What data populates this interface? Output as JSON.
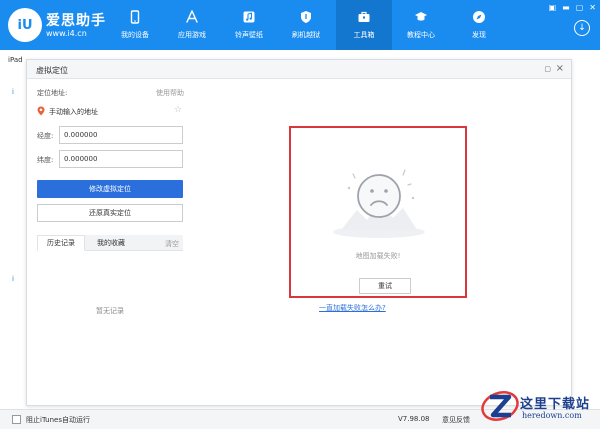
{
  "app": {
    "brand_name": "爱思助手",
    "brand_url": "www.i4.cn",
    "logo_text": "iU"
  },
  "nav": {
    "items": [
      {
        "label": "我的设备",
        "icon": "phone-icon"
      },
      {
        "label": "应用游戏",
        "icon": "app-store-icon"
      },
      {
        "label": "铃声壁纸",
        "icon": "music-icon"
      },
      {
        "label": "刷机越狱",
        "icon": "shield-icon"
      },
      {
        "label": "工具箱",
        "icon": "toolbox-icon"
      },
      {
        "label": "教程中心",
        "icon": "graduation-cap-icon"
      },
      {
        "label": "发现",
        "icon": "compass-icon"
      }
    ],
    "active_index": 4
  },
  "window_controls": [
    "▣",
    "▬",
    "▢",
    "✕"
  ],
  "background": {
    "header_text": "iPad",
    "marks": [
      "i",
      "i"
    ]
  },
  "modal": {
    "title": "虚拟定位",
    "address_label": "定位地址:",
    "help_label": "使用帮助",
    "address_placeholder": "手动输入的地址",
    "longitude_label": "经度:",
    "longitude_value": "0.000000",
    "latitude_label": "纬度:",
    "latitude_value": "0.000000",
    "modify_button": "修改虚拟定位",
    "restore_button": "还原真实定位",
    "tabs": [
      "历史记录",
      "我的收藏"
    ],
    "clear_label": "清空",
    "empty_text": "暂无记录",
    "map_fail_text": "地图加载失败!",
    "retry_button": "重试",
    "map_help_link": "一直加载失败怎么办?"
  },
  "status_bar": {
    "itunes_label": "阻止iTunes自动运行",
    "version": "V7.98.08",
    "feedback": "意见反馈"
  },
  "watermark": {
    "cn": "这里下载站",
    "en": "heredown.com"
  },
  "colors": {
    "brand_blue": "#1a8cf0",
    "active_nav": "#1376cf",
    "primary_button": "#2b6fdc",
    "highlight_red": "#d9363e"
  }
}
